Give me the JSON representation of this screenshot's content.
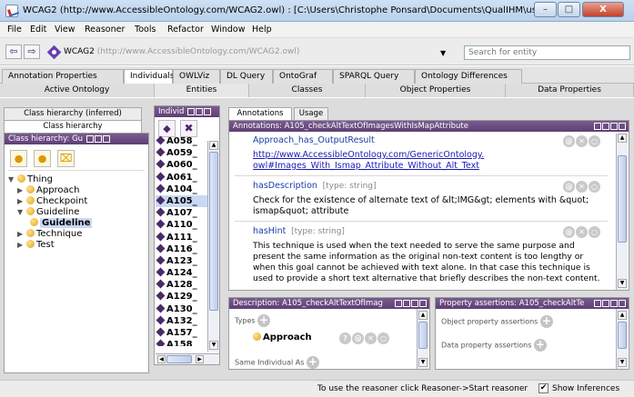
{
  "window": {
    "title": "WCAG2 (http://www.AccessibleOntology.com/WCAG2.owl) : [C:\\Users\\Christophe Ponsard\\Documents\\QualIHM\\usi...",
    "minimize": "–",
    "maximize": "□",
    "close": "X"
  },
  "menu": [
    "File",
    "Edit",
    "View",
    "Reasoner",
    "Tools",
    "Refactor",
    "Window",
    "Help"
  ],
  "nav": {
    "back": "⇦",
    "forward": "⇨",
    "ontology_name": "WCAG2",
    "ontology_url": "(http://www.AccessibleOntology.com/WCAG2.owl)",
    "dropdown": "▼",
    "search_placeholder": "Search for entity"
  },
  "tabs_primary": [
    "Annotation Properties",
    "Individuals",
    "OWLViz",
    "DL Query",
    "OntoGraf",
    "SPARQL Query",
    "Ontology Differences"
  ],
  "tabs_secondary": [
    "Active Ontology",
    "Entities",
    "Classes",
    "Object Properties",
    "Data Properties"
  ],
  "class_panel": {
    "tab_inferred": "Class hierarchy (inferred)",
    "tab_hierarchy": "Class hierarchy",
    "header": "Class hierarchy: Gu",
    "tree": [
      {
        "label": "Thing"
      },
      {
        "label": "Approach"
      },
      {
        "label": "Checkpoint"
      },
      {
        "label": "Guideline"
      },
      {
        "label": "Guideline"
      },
      {
        "label": "Technique"
      },
      {
        "label": "Test"
      }
    ]
  },
  "individuals_panel": {
    "header": "Individ",
    "items": [
      "A058_",
      "A059_",
      "A060_",
      "A061_",
      "A104_",
      "A105_",
      "A107_",
      "A110_",
      "A111_",
      "A116_",
      "A123_",
      "A124_",
      "A128_",
      "A129_",
      "A130_",
      "A132_",
      "A157_",
      "A158_"
    ],
    "selected_index": 5
  },
  "annotations_panel": {
    "tab_annotations": "Annotations",
    "tab_usage": "Usage",
    "header": "Annotations: A105_checkAltTextOfImagesWithIsMapAttribute",
    "entries": [
      {
        "property": "Approach_has_OutputResult",
        "type": "",
        "lines": [
          "http://www.AccessibleOntology.com/GenericOntology.",
          "owl#Images_With_Ismap_Attribute_Without_Alt_Text"
        ]
      },
      {
        "property": "hasDescription",
        "type": "[type: string]",
        "lines": [
          "Check for the existence of alternate text of &lt;IMG&gt; elements with &quot;",
          "ismap&quot; attribute"
        ]
      },
      {
        "property": "hasHint",
        "type": "[type: string]",
        "lines": [
          "This technique is used when the text needed to serve the same purpose and",
          "present the same information as the original non-text content is too lengthy or",
          "when this goal cannot be achieved with text alone. In that case this technique is",
          "used to provide a short text alternative that briefly describes the non-text content."
        ]
      }
    ]
  },
  "description_panel": {
    "header": "Description: A105_checkAltTextOfImag",
    "types_label": "Types",
    "type_value": "Approach",
    "same_individual_label": "Same Individual As"
  },
  "property_panel": {
    "header": "Property assertions: A105_checkAltTe",
    "object_label": "Object property assertions",
    "data_label": "Data property assertions"
  },
  "status": {
    "message": "To use the reasoner click Reasoner->Start reasoner",
    "show_inferences": "Show Inferences",
    "show_inferences_checked": true
  },
  "colors": {
    "panel_header": "#5e3f74",
    "link": "#1a1ab8",
    "class_dot": "#e0a21a",
    "individual_diamond": "#4a2a6a"
  }
}
